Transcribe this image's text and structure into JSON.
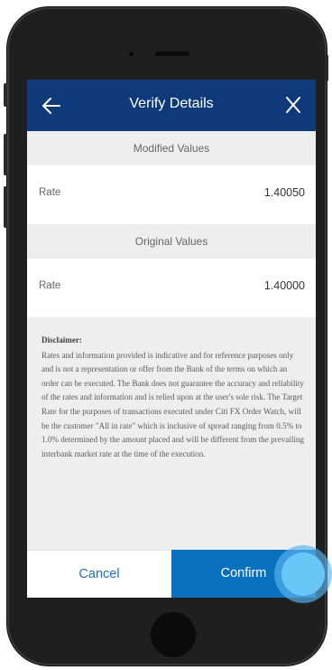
{
  "header": {
    "title": "Verify Details",
    "back_icon": "arrow-left-icon",
    "close_icon": "close-x-icon"
  },
  "modified": {
    "heading": "Modified Values",
    "rate_label": "Rate",
    "rate_value": "1.40050"
  },
  "original": {
    "heading": "Original Values",
    "rate_label": "Rate",
    "rate_value": "1.40000"
  },
  "disclaimer": {
    "title": "Disclaimer:",
    "text": "Rates and information provided is indicative and for reference purposes only and is not a representation or offer from the Bank of the terms on which an order can be executed. The Bank does not guarantee the accuracy and reliability of the rates and information and is relied upon at the user's sole risk. The Target Rate for the purposes of transactions executed under Citi FX Order Watch, will be the customer \"All in rate\" which is inclusive of spread ranging from 0.5% to 1.0% determined by the amount placed and will be different from the prevailing interbank market rate at the time of the execution."
  },
  "footer": {
    "cancel_label": "Cancel",
    "confirm_label": "Confirm"
  },
  "colors": {
    "header_bg": "#0f3a7a",
    "confirm_bg": "#0a70c0",
    "cancel_text": "#1f6fbf",
    "touch_indicator": "#69c7f7"
  }
}
